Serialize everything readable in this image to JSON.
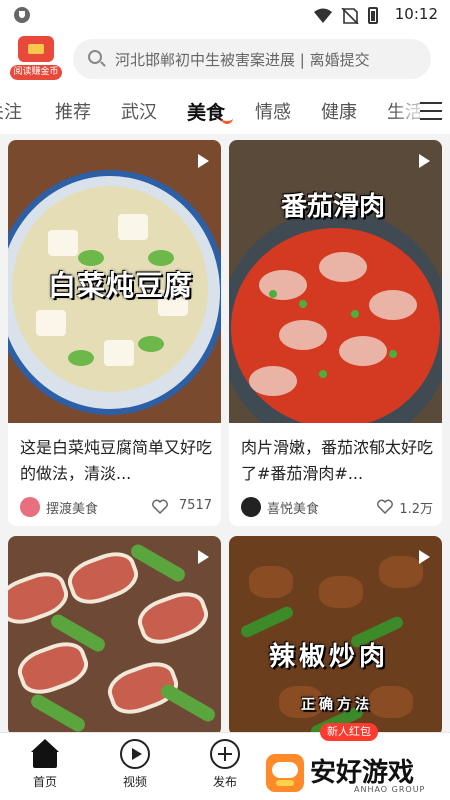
{
  "status_bar": {
    "time": "10:12"
  },
  "header": {
    "coin_label": "阅读赚金币",
    "search_placeholder": "河北邯郸初中生被害案进展 | 离婚提交"
  },
  "tabs": [
    {
      "label": "关注"
    },
    {
      "label": "推荐"
    },
    {
      "label": "武汉"
    },
    {
      "label": "美食",
      "active": true
    },
    {
      "label": "情感"
    },
    {
      "label": "健康"
    },
    {
      "label": "生活"
    }
  ],
  "accent_color": "#ff5a2a",
  "feed": [
    {
      "overlay": "白菜炖豆腐",
      "title": "这是白菜炖豆腐简单又好吃的做法，清淡...",
      "author": "摆渡美食",
      "likes": "7517"
    },
    {
      "overlay": "番茄滑肉",
      "title": "肉片滑嫩，番茄浓郁太好吃了#番茄滑肉#...",
      "author": "喜悦美食",
      "likes": "1.2万"
    },
    {
      "overlay": "",
      "title": "",
      "author": "",
      "likes": ""
    },
    {
      "overlay": "辣椒炒肉",
      "overlay_sub": "正确方法",
      "title": "",
      "author": "",
      "likes": ""
    }
  ],
  "bottom_nav": [
    {
      "label": "首页",
      "icon": "home-icon",
      "active": true
    },
    {
      "label": "视频",
      "icon": "video-icon"
    },
    {
      "label": "发布",
      "icon": "publish-icon"
    }
  ],
  "newbie_badge": "新人红包",
  "watermark": {
    "text": "安好游戏",
    "sub": "ANHAO GROUP"
  }
}
